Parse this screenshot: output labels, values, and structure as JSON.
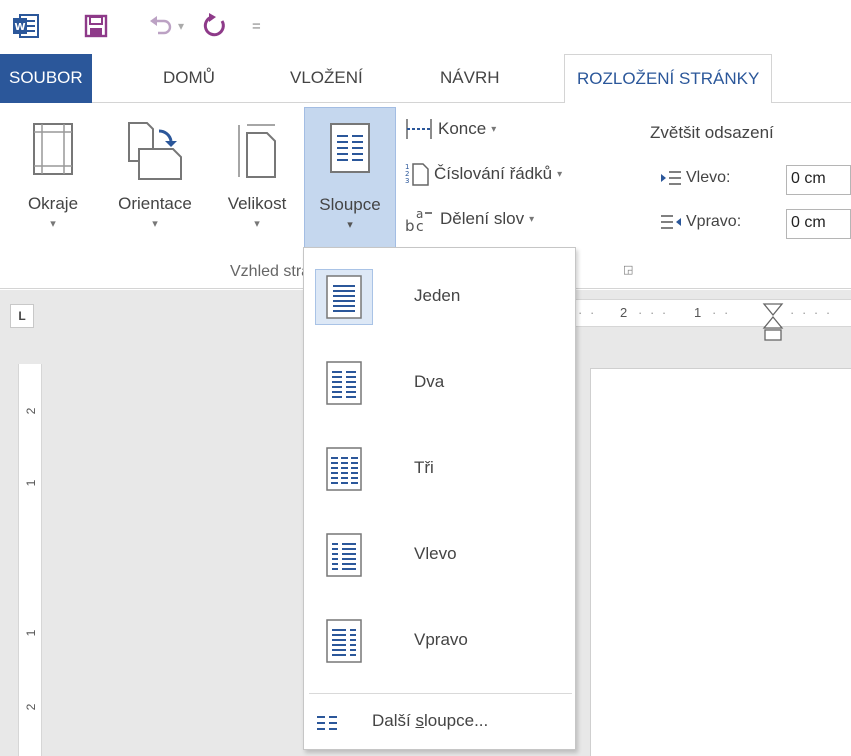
{
  "qat": {
    "icons": [
      "word-logo-icon",
      "save-icon",
      "undo-icon",
      "redo-icon",
      "customize-qat-icon"
    ],
    "undo_dropdown": "▾",
    "customize_glyph": "="
  },
  "tabs": [
    {
      "label": "SOUBOR"
    },
    {
      "label": "DOMŮ"
    },
    {
      "label": "VLOŽENÍ"
    },
    {
      "label": "NÁVRH"
    },
    {
      "label": "ROZLOŽENÍ STRÁNKY"
    }
  ],
  "ribbon": {
    "big_buttons": [
      {
        "label": "Okraje",
        "icon": "margins-icon"
      },
      {
        "label": "Orientace",
        "icon": "orientation-icon"
      },
      {
        "label": "Velikost",
        "icon": "size-icon"
      },
      {
        "label": "Sloupce",
        "icon": "columns-icon"
      }
    ],
    "small_buttons": [
      {
        "label": "Konce",
        "icon": "breaks-icon"
      },
      {
        "label": "Číslování řádků",
        "icon": "line-numbers-icon"
      },
      {
        "label": "Dělení slov",
        "icon": "hyphenation-icon"
      }
    ],
    "group_label": "Vzhled stránky",
    "indent": {
      "title": "Zvětšit odsazení",
      "left_label": "Vlevo:",
      "left_value": "0 cm",
      "right_label": "Vpravo:",
      "right_value": "0 cm"
    }
  },
  "ruler": {
    "horizontal_ticks": [
      "2",
      "1"
    ],
    "vertical_ticks": [
      "2",
      "1",
      "1",
      "2"
    ],
    "corner_glyph": "L"
  },
  "columns_menu": {
    "items": [
      {
        "label": "Jeden",
        "selected": true
      },
      {
        "label": "Dva",
        "selected": false
      },
      {
        "label": "Tři",
        "selected": false
      },
      {
        "label": "Vlevo",
        "selected": false
      },
      {
        "label": "Vpravo",
        "selected": false
      }
    ],
    "more_label_prefix": "Další ",
    "more_label_accel": "s",
    "more_label_suffix": "loupce..."
  },
  "colors": {
    "file_tab": "#2b579a",
    "pressed": "#c5d7ee",
    "icon_blue": "#2b579a",
    "icon_purple": "#8e3a89"
  }
}
